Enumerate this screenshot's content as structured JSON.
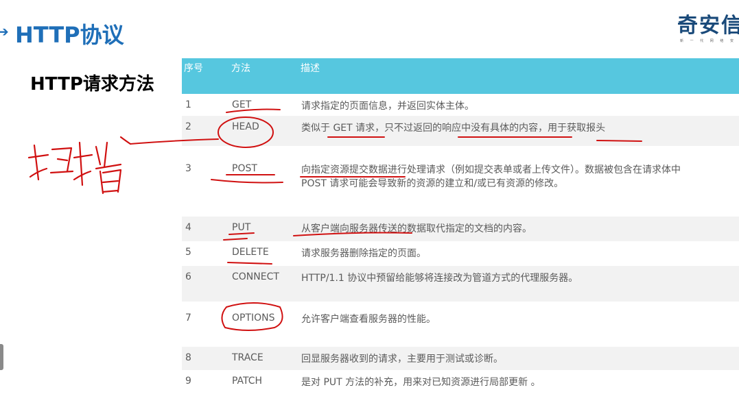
{
  "header": {
    "title": "HTTP协议",
    "subtitle": "HTTP请求方法",
    "logo_main": "奇安信",
    "logo_sub": "新 一 代 网 络 安"
  },
  "table": {
    "columns": [
      "序号",
      "方法",
      "描述"
    ],
    "rows": [
      {
        "num": "1",
        "method": "GET",
        "desc": "请求指定的页面信息，并返回实体主体。"
      },
      {
        "num": "2",
        "method": "HEAD",
        "desc": "类似于 GET 请求，只不过返回的响应中没有具体的内容，用于获取报头"
      },
      {
        "num": "3",
        "method": "POST",
        "desc": "向指定资源提交数据进行处理请求（例如提交表单或者上传文件）。数据被包含在请求体中",
        "desc2": "POST 请求可能会导致新的资源的建立和/或已有资源的修改。"
      },
      {
        "num": "4",
        "method": "PUT",
        "desc": "从客户端向服务器传送的数据取代指定的文档的内容。"
      },
      {
        "num": "5",
        "method": "DELETE",
        "desc": "请求服务器删除指定的页面。"
      },
      {
        "num": "6",
        "method": "CONNECT",
        "desc": "HTTP/1.1 协议中预留给能够将连接改为管道方式的代理服务器。"
      },
      {
        "num": "7",
        "method": "OPTIONS",
        "desc": "允许客户端查看服务器的性能。"
      },
      {
        "num": "8",
        "method": "TRACE",
        "desc": "回显服务器收到的请求，主要用于测试或诊断。"
      },
      {
        "num": "9",
        "method": "PATCH",
        "desc": "是对 PUT 方法的补充，用来对已知资源进行局部更新 。"
      }
    ]
  },
  "annotation": {
    "handwritten_note": "扫描",
    "ink_color": "#d01010"
  }
}
